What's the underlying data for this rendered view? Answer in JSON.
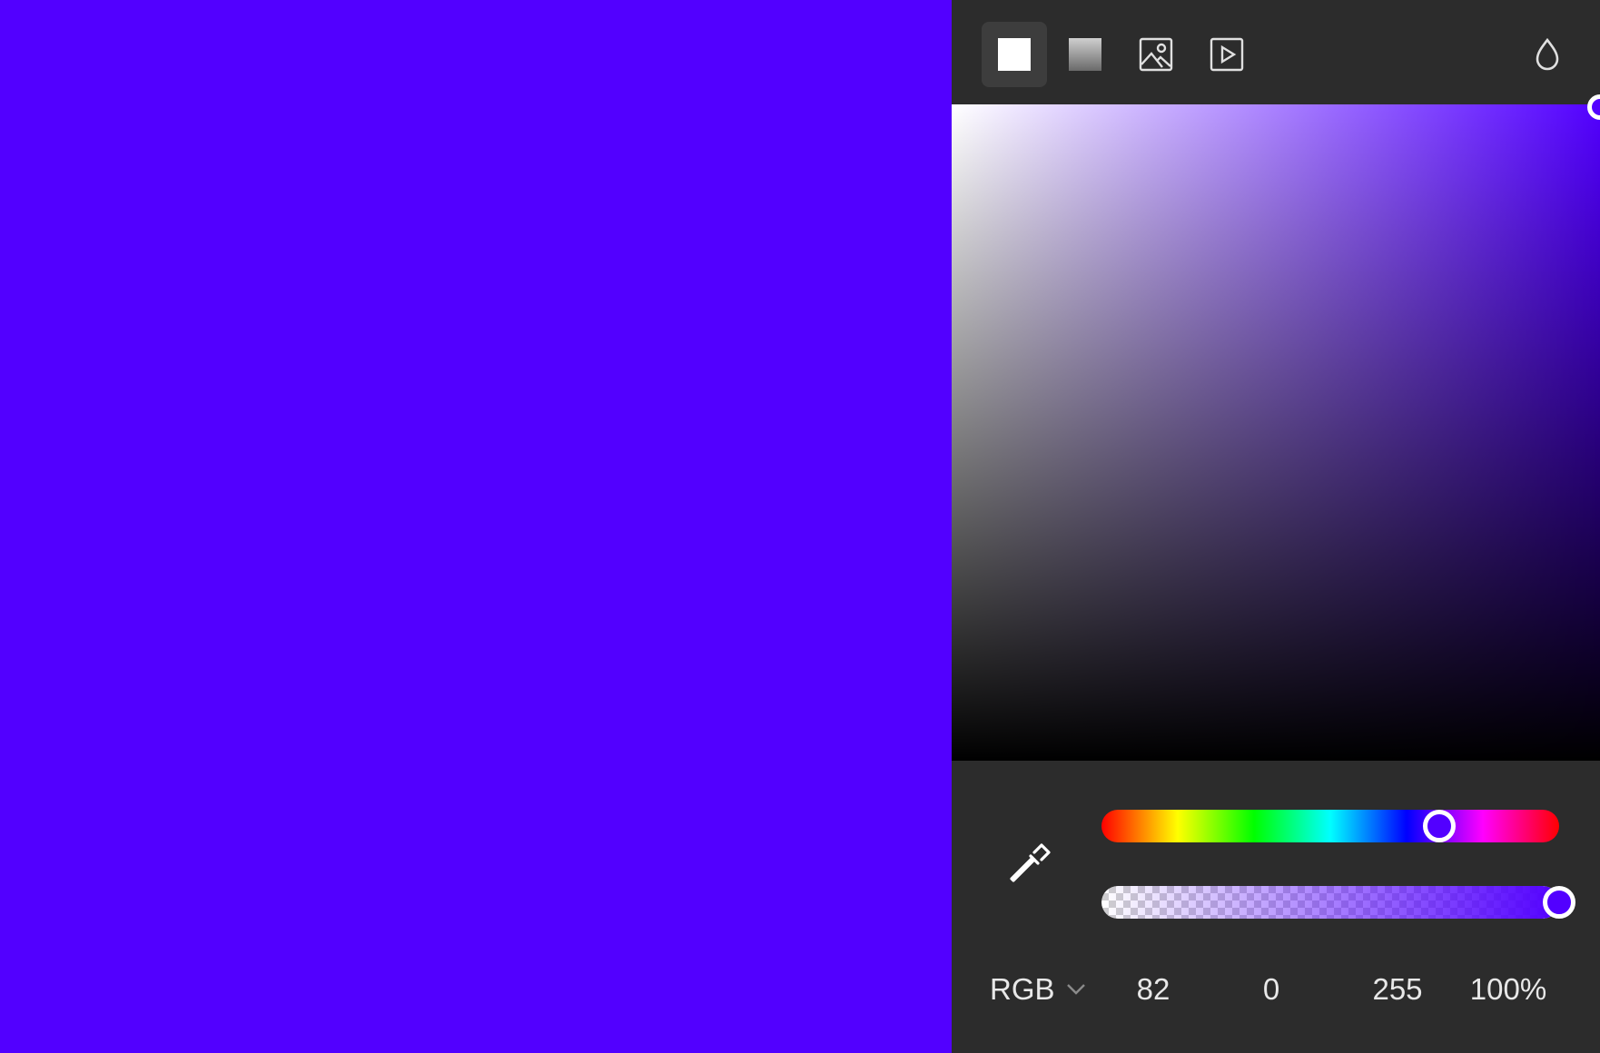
{
  "colors": {
    "selected": "#5200ff",
    "hue": "#5200ff",
    "panel_bg": "#2c2c2c",
    "tab_active_bg": "#3d3d3d"
  },
  "fill_tabs": [
    {
      "name": "solid",
      "icon": "solid-fill-icon",
      "active": true
    },
    {
      "name": "gradient",
      "icon": "gradient-fill-icon",
      "active": false
    },
    {
      "name": "image",
      "icon": "image-fill-icon",
      "active": false
    },
    {
      "name": "video",
      "icon": "video-fill-icon",
      "active": false
    }
  ],
  "opacity_icon": "drop-icon",
  "eyedropper_icon": "eyedropper-icon",
  "color_mode": {
    "label": "RGB",
    "icon": "chevron-down-icon"
  },
  "values": {
    "r": "82",
    "g": "0",
    "b": "255",
    "a": "100%"
  },
  "levels": {
    "hue_fraction": 0.7,
    "alpha_percent": 100,
    "saturation": 1.0,
    "brightness": 1.0
  }
}
